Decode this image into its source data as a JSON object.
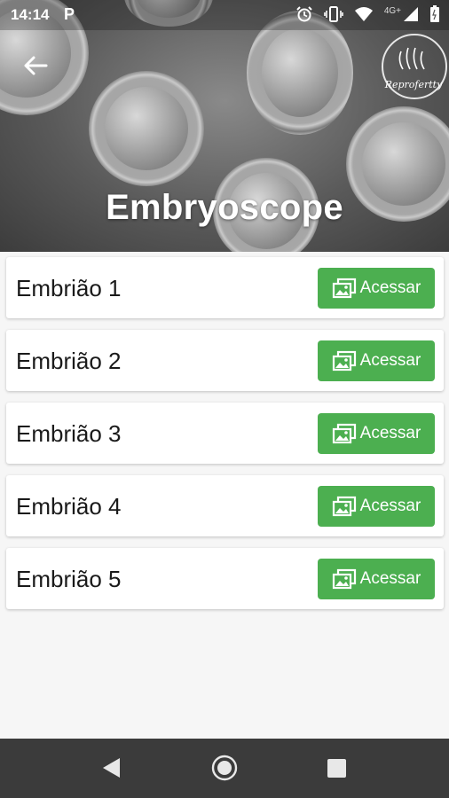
{
  "status_bar": {
    "time": "14:14",
    "notification_icon": "P",
    "network_label": "4G+"
  },
  "header": {
    "title": "Embryoscope",
    "logo_text": "Reprofertty",
    "back_icon": "arrow-left-icon"
  },
  "embryos": [
    {
      "label": "Embrião 1",
      "button": "Acessar"
    },
    {
      "label": "Embrião 2",
      "button": "Acessar"
    },
    {
      "label": "Embrião 3",
      "button": "Acessar"
    },
    {
      "label": "Embrião 4",
      "button": "Acessar"
    },
    {
      "label": "Embrião 5",
      "button": "Acessar"
    }
  ],
  "colors": {
    "accent_green": "#4caf50",
    "nav_bar": "#3b3b3b",
    "background": "#f6f6f6"
  }
}
